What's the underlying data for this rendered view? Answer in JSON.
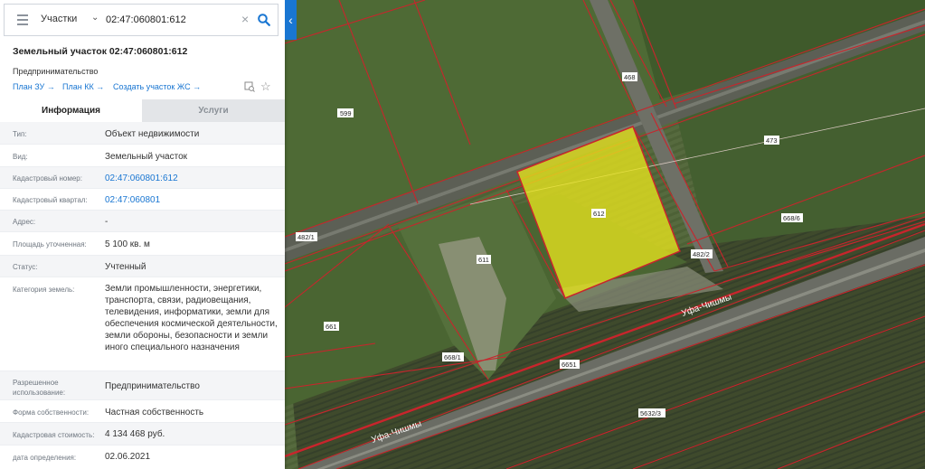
{
  "search": {
    "type_label": "Участки",
    "query": "02:47:060801:612"
  },
  "object": {
    "title": "Земельный участок 02:47:060801:612",
    "subtitle": "Предпринимательство",
    "links": [
      "План ЗУ →",
      "План КК →",
      "Создать участок ЖС →"
    ]
  },
  "tabs": [
    "Информация",
    "Услуги"
  ],
  "info_rows": [
    {
      "label": "Тип:",
      "value": "Объект недвижимости"
    },
    {
      "label": "Вид:",
      "value": "Земельный участок"
    },
    {
      "label": "Кадастровый номер:",
      "value": "02:47:060801:612",
      "link": true
    },
    {
      "label": "Кадастровый квартал:",
      "value": "02:47:060801",
      "link": true
    },
    {
      "label": "Адрес:",
      "value": "-"
    },
    {
      "label": "Площадь уточненная:",
      "value": "5 100 кв. м"
    },
    {
      "label": "Статус:",
      "value": "Учтенный"
    },
    {
      "label": "Категория земель:",
      "value": "Земли промышленности, энергетики, транспорта, связи, радиовещания, телевидения, информатики, земли для обеспечения космической деятельности, земли обороны, безопасности и земли иного специального назначения"
    },
    {
      "label": "Разрешенное использование:",
      "value": "Предпринимательство"
    },
    {
      "label": "Форма собственности:",
      "value": "Частная собственность"
    },
    {
      "label": "Кадастровая стоимость:",
      "value": "4 134 468 руб."
    },
    {
      "label": "дата определения:",
      "value": "02.06.2021"
    }
  ],
  "map_labels": {
    "l599": "599",
    "l468": "468",
    "l473": "473",
    "l612": "612",
    "l611": "611",
    "l482_1": "482/1",
    "l482_2": "482/2",
    "l668_6": "668/6",
    "l661": "661",
    "l668_1": "668/1",
    "l6651": "6651",
    "l5632_3": "5632/3",
    "road1": "Уфа-Чишмы",
    "road2": "Уфа-Чишмы"
  },
  "colors": {
    "accent": "#1976d2",
    "parcel_border": "#c8252c",
    "selected_fill": "#e7e41e"
  }
}
